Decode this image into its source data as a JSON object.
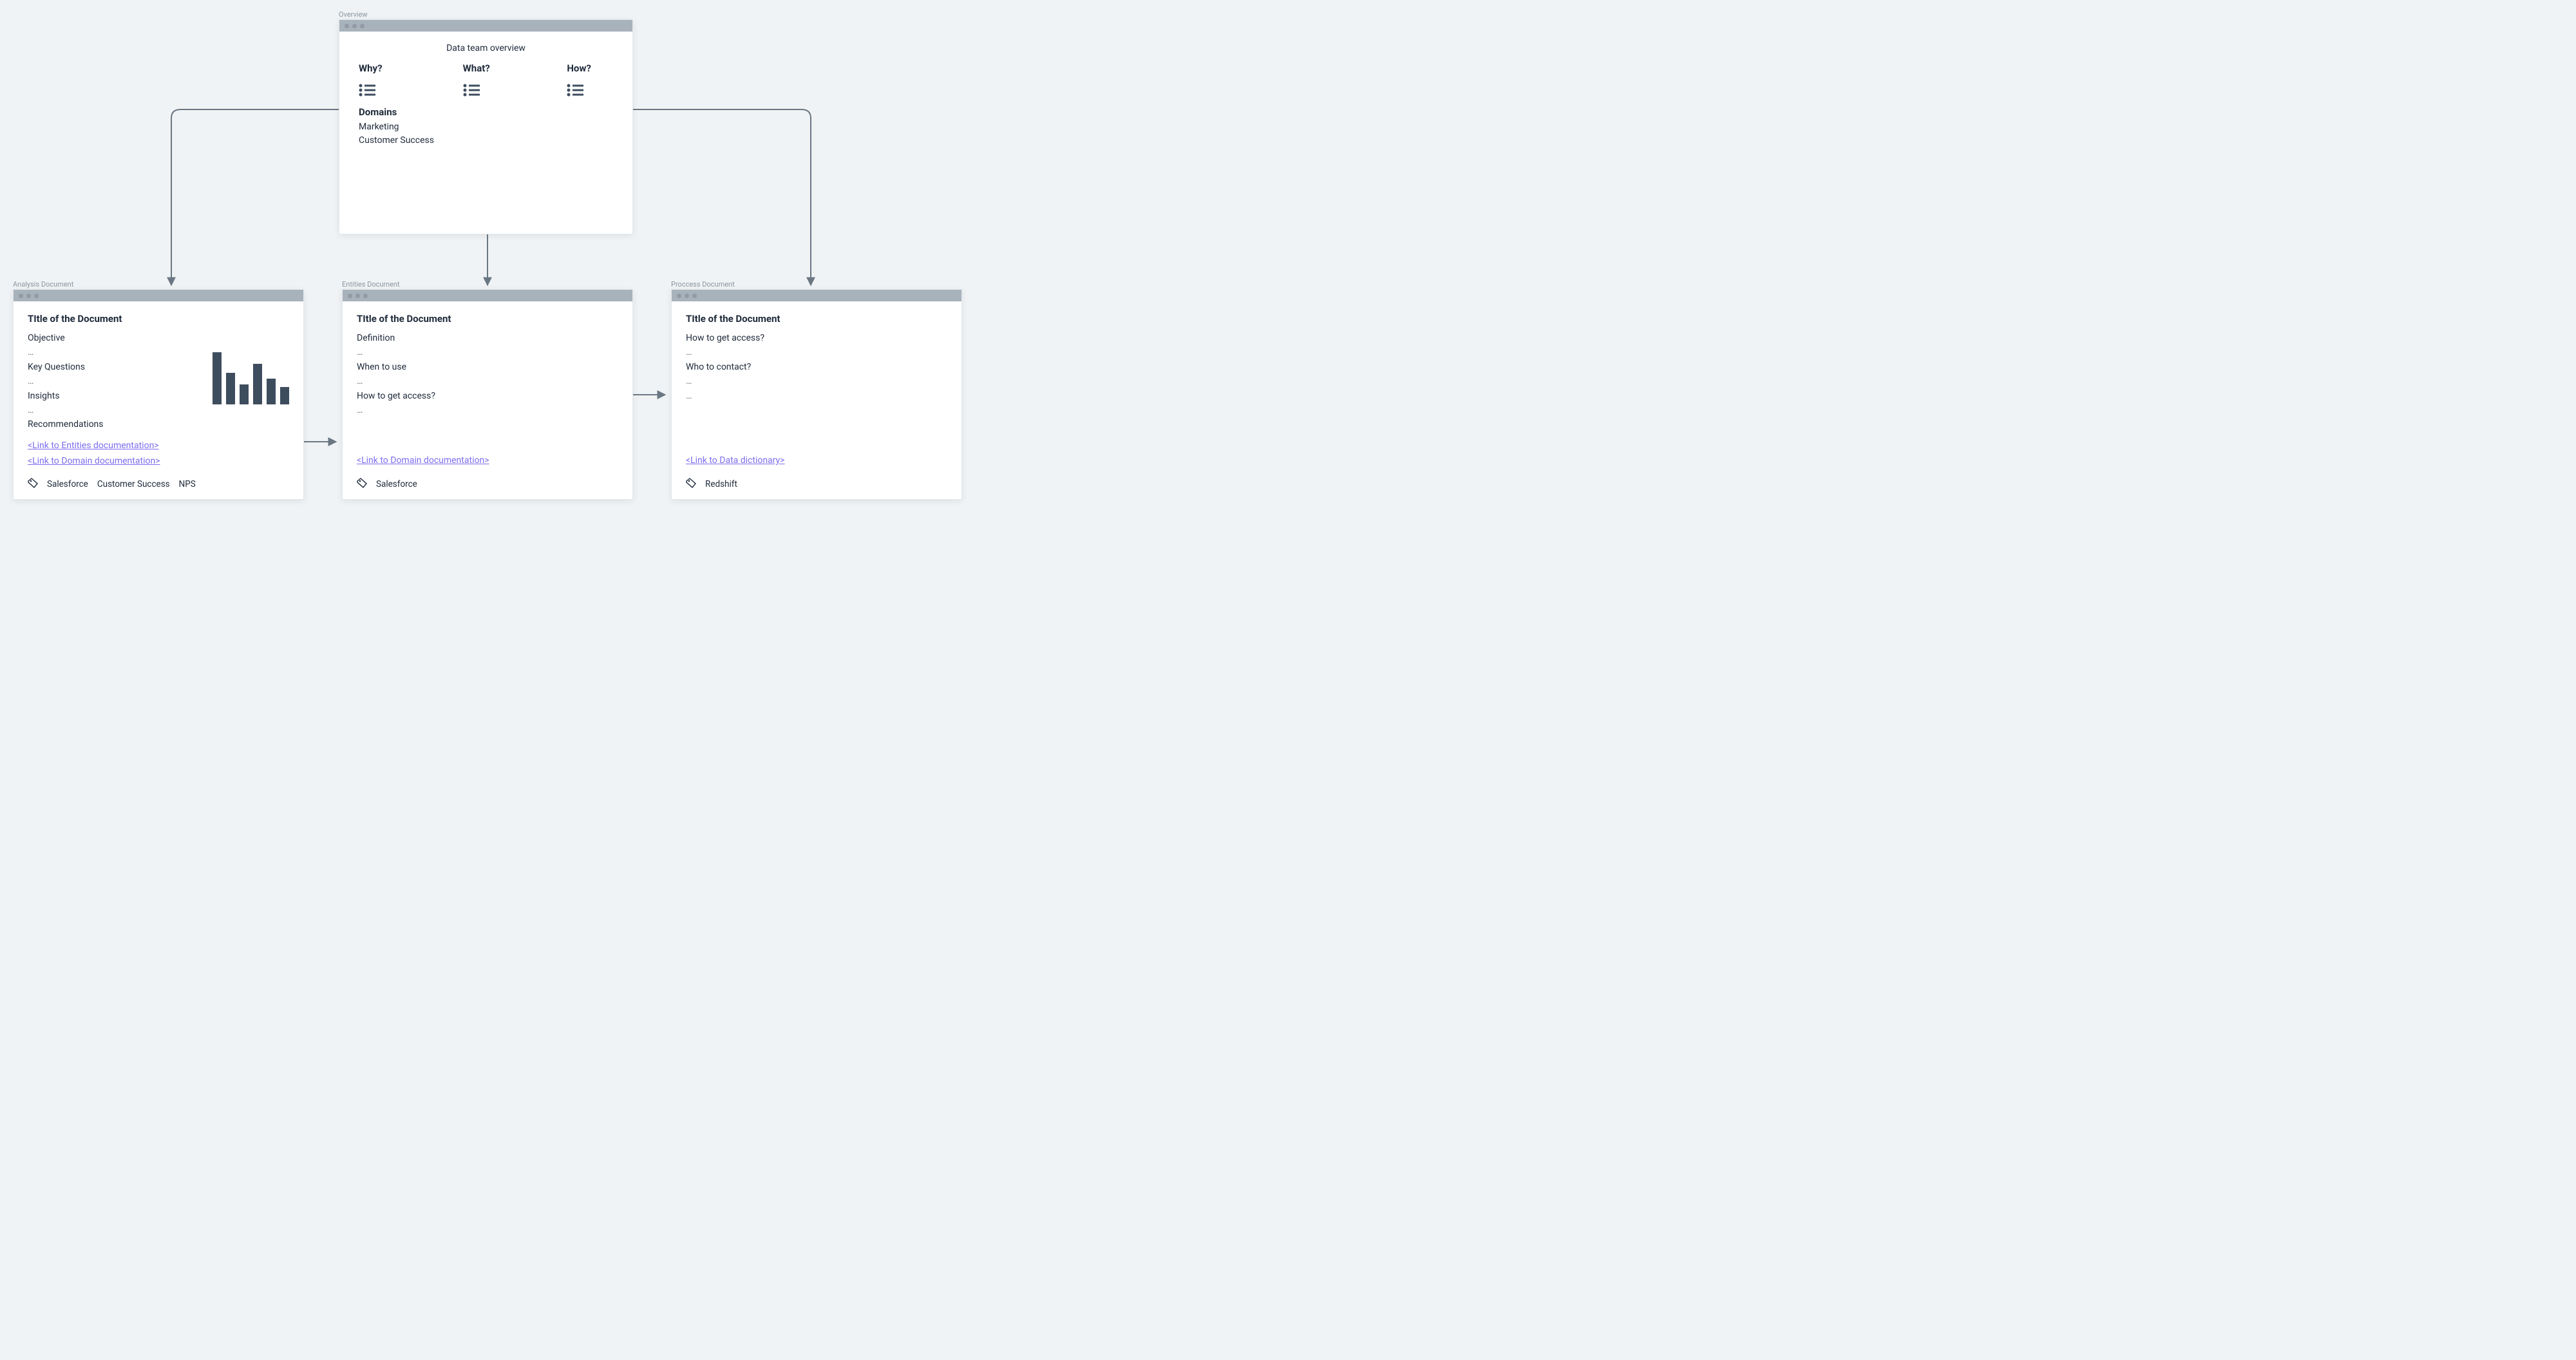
{
  "overview": {
    "label": "Overview",
    "title": "Data team overview",
    "cols": [
      {
        "q": "Why?"
      },
      {
        "q": "What?"
      },
      {
        "q": "How?"
      }
    ],
    "domains_heading": "Domains",
    "domains": [
      "Marketing",
      "Customer Success"
    ]
  },
  "cards": {
    "analysis": {
      "label": "Analysis Document",
      "title": "TItle of the Document",
      "lines": [
        "Objective",
        "…",
        "Key Questions",
        "…",
        "Insights",
        "…",
        "Recommendations"
      ],
      "links": [
        "<Link to Entities documentation>",
        "<Link to Domain documentation>"
      ],
      "tags": [
        "Salesforce",
        "Customer Success",
        "NPS"
      ]
    },
    "entities": {
      "label": "Entities Document",
      "title": "TItle of the Document",
      "lines": [
        "Definition",
        "…",
        "When to use",
        "…",
        "How to get access?",
        "…"
      ],
      "links": [
        "<Link to Domain documentation>"
      ],
      "tags": [
        "Salesforce"
      ]
    },
    "process": {
      "label": "Proccess Document",
      "title": "TItle of the Document",
      "lines": [
        "How to get access?",
        "…",
        "Who to contact?",
        "…",
        "…"
      ],
      "links": [
        "<Link to Data dictionary>"
      ],
      "tags": [
        "Redshift"
      ]
    }
  },
  "chart_data": {
    "type": "bar",
    "note": "decorative glyph inside Analysis Document — no axes or labels shown",
    "values": [
      90,
      55,
      35,
      70,
      45,
      30
    ]
  }
}
